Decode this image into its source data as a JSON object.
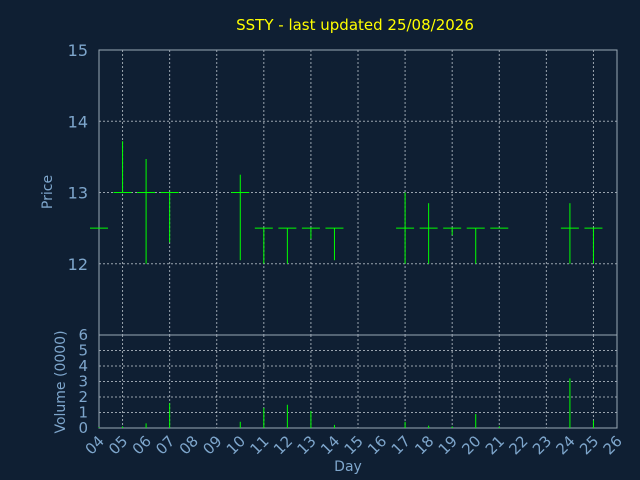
{
  "chart_data": [
    {
      "type": "ohlc",
      "title": "SSTY - last updated 25/08/2026",
      "ylabel": "Price",
      "ylim": [
        11,
        15
      ],
      "yticks": [
        12,
        13,
        14,
        15
      ],
      "grid": true,
      "series": [
        {
          "day": "04",
          "high": 12.5,
          "low": 12.5,
          "open": 12.5,
          "close": 12.5
        },
        {
          "day": "05",
          "high": 13.72,
          "low": 13.0,
          "open": 13.0,
          "close": 13.0
        },
        {
          "day": "06",
          "high": 13.47,
          "low": 12.0,
          "open": 13.0,
          "close": 13.0
        },
        {
          "day": "07",
          "high": 13.0,
          "low": 12.3,
          "open": 13.0,
          "close": 13.0
        },
        {
          "day": "10",
          "high": 13.25,
          "low": 12.05,
          "open": 13.0,
          "close": 13.0
        },
        {
          "day": "11",
          "high": 12.5,
          "low": 12.0,
          "open": 12.5,
          "close": 12.5
        },
        {
          "day": "12",
          "high": 12.5,
          "low": 12.0,
          "open": 12.5,
          "close": 12.5
        },
        {
          "day": "13",
          "high": 12.5,
          "low": 12.35,
          "open": 12.5,
          "close": 12.5
        },
        {
          "day": "14",
          "high": 12.5,
          "low": 12.05,
          "open": 12.5,
          "close": 12.5
        },
        {
          "day": "17",
          "high": 13.0,
          "low": 12.0,
          "open": 12.5,
          "close": 12.5
        },
        {
          "day": "18",
          "high": 12.85,
          "low": 12.0,
          "open": 12.5,
          "close": 12.5
        },
        {
          "day": "19",
          "high": 12.5,
          "low": 12.4,
          "open": 12.5,
          "close": 12.5
        },
        {
          "day": "20",
          "high": 12.5,
          "low": 12.0,
          "open": 12.5,
          "close": 12.5
        },
        {
          "day": "21",
          "high": 12.5,
          "low": 12.5,
          "open": 12.5,
          "close": 12.5
        },
        {
          "day": "24",
          "high": 12.85,
          "low": 12.0,
          "open": 12.5,
          "close": 12.5
        },
        {
          "day": "25",
          "high": 12.5,
          "low": 12.0,
          "open": 12.5,
          "close": 12.5
        }
      ]
    },
    {
      "type": "bar",
      "ylabel": "Volume (0000)",
      "xlabel": "Day",
      "ylim": [
        0,
        6
      ],
      "yticks": [
        0,
        1,
        2,
        3,
        4,
        5,
        6
      ],
      "categories": [
        "04",
        "05",
        "06",
        "07",
        "08",
        "09",
        "10",
        "11",
        "12",
        "13",
        "14",
        "15",
        "16",
        "17",
        "18",
        "19",
        "20",
        "21",
        "22",
        "23",
        "24",
        "25",
        "26"
      ],
      "values": [
        0.05,
        0.1,
        0.3,
        1.6,
        0,
        0,
        0.4,
        1.3,
        1.5,
        1.1,
        0.2,
        0,
        0,
        0.4,
        0.15,
        0.1,
        0.9,
        0.1,
        0,
        0,
        3.2,
        0.5,
        0
      ]
    }
  ],
  "colors": {
    "background": "#0f1f33",
    "title": "#ffff00",
    "text": "#7ea6cc",
    "bars": "#00ff00",
    "frame": "#9aa8b6",
    "grid": "#c8d0d8"
  }
}
